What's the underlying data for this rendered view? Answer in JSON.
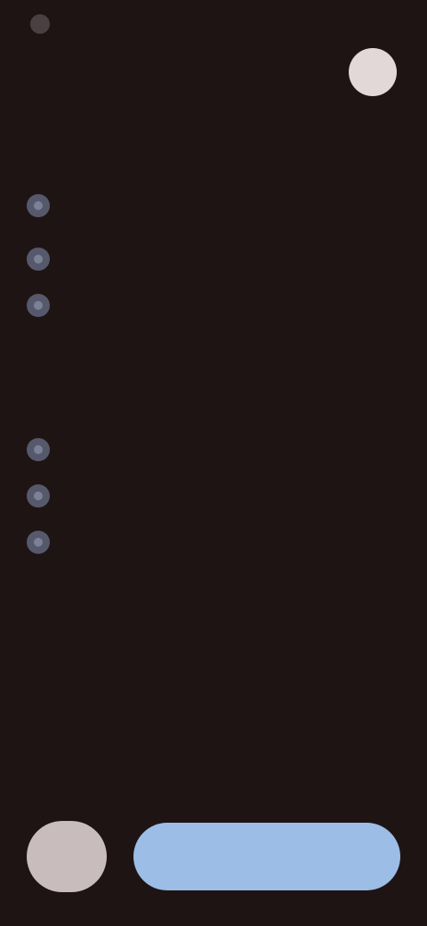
{
  "status_bar": {
    "title": ""
  },
  "content": {
    "heading_1": "",
    "list_1": [
      "",
      "",
      ""
    ],
    "heading_2": "",
    "list_2": [
      "",
      "",
      ""
    ]
  },
  "actions": {
    "secondary_label": "",
    "primary_label": ""
  },
  "colors": {
    "background": "#1f1414",
    "avatar": "#e2d8d8",
    "icon": "#55596b",
    "primary_button": "#9cbde6",
    "secondary_button": "#c9bcbc"
  }
}
